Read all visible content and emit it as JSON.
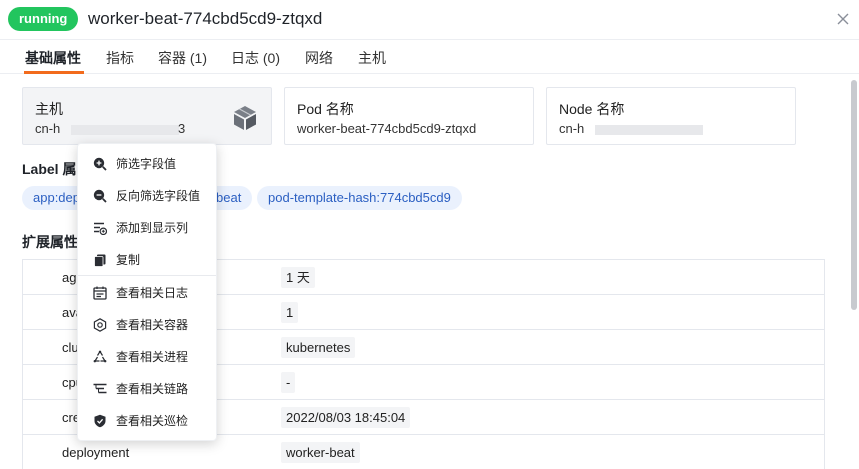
{
  "header": {
    "status": "running",
    "title": "worker-beat-774cbd5cd9-ztqxd",
    "close_icon": "close-icon"
  },
  "tabs": [
    {
      "label": "基础属性",
      "active": true
    },
    {
      "label": "指标"
    },
    {
      "label": "容器 (1)"
    },
    {
      "label": "日志 (0)"
    },
    {
      "label": "网络"
    },
    {
      "label": "主机"
    }
  ],
  "cards": {
    "host": {
      "label": "主机",
      "value": "cn-h",
      "value_suffix": "3",
      "icon": "cube-icon"
    },
    "pod": {
      "label": "Pod 名称",
      "value": "worker-beat-774cbd5cd9-ztqxd"
    },
    "node": {
      "label": "Node 名称",
      "value": "cn-h"
    }
  },
  "labels_section": {
    "title": "Label 属",
    "chips": [
      "app:dep",
      "beat",
      "pod-template-hash:774cbd5cd9"
    ]
  },
  "ext_section": {
    "title": "扩展属性",
    "rows": [
      {
        "key": "ag",
        "value": "1 天"
      },
      {
        "key": "ava",
        "value": "1"
      },
      {
        "key": "clu",
        "value": "kubernetes"
      },
      {
        "key": "cpu",
        "value": "-"
      },
      {
        "key": "cre",
        "value": "2022/08/03 18:45:04"
      },
      {
        "key": "deployment",
        "value": "worker-beat"
      }
    ]
  },
  "context_menu": {
    "items": [
      {
        "label": "筛选字段值",
        "icon": "zoom-in-icon"
      },
      {
        "label": "反向筛选字段值",
        "icon": "zoom-out-icon"
      },
      {
        "label": "添加到显示列",
        "icon": "add-column-icon"
      },
      {
        "label": "复制",
        "icon": "copy-icon"
      },
      {
        "label": "查看相关日志",
        "icon": "calendar-log-icon"
      },
      {
        "label": "查看相关容器",
        "icon": "hexagon-container-icon"
      },
      {
        "label": "查看相关进程",
        "icon": "process-icon"
      },
      {
        "label": "查看相关链路",
        "icon": "trace-icon"
      },
      {
        "label": "查看相关巡检",
        "icon": "shield-check-icon"
      }
    ]
  },
  "colors": {
    "status": "#22c55e",
    "tab_accent": "#f26b1d",
    "chip_bg": "#eaf1fd",
    "chip_text": "#2b5fc2"
  }
}
